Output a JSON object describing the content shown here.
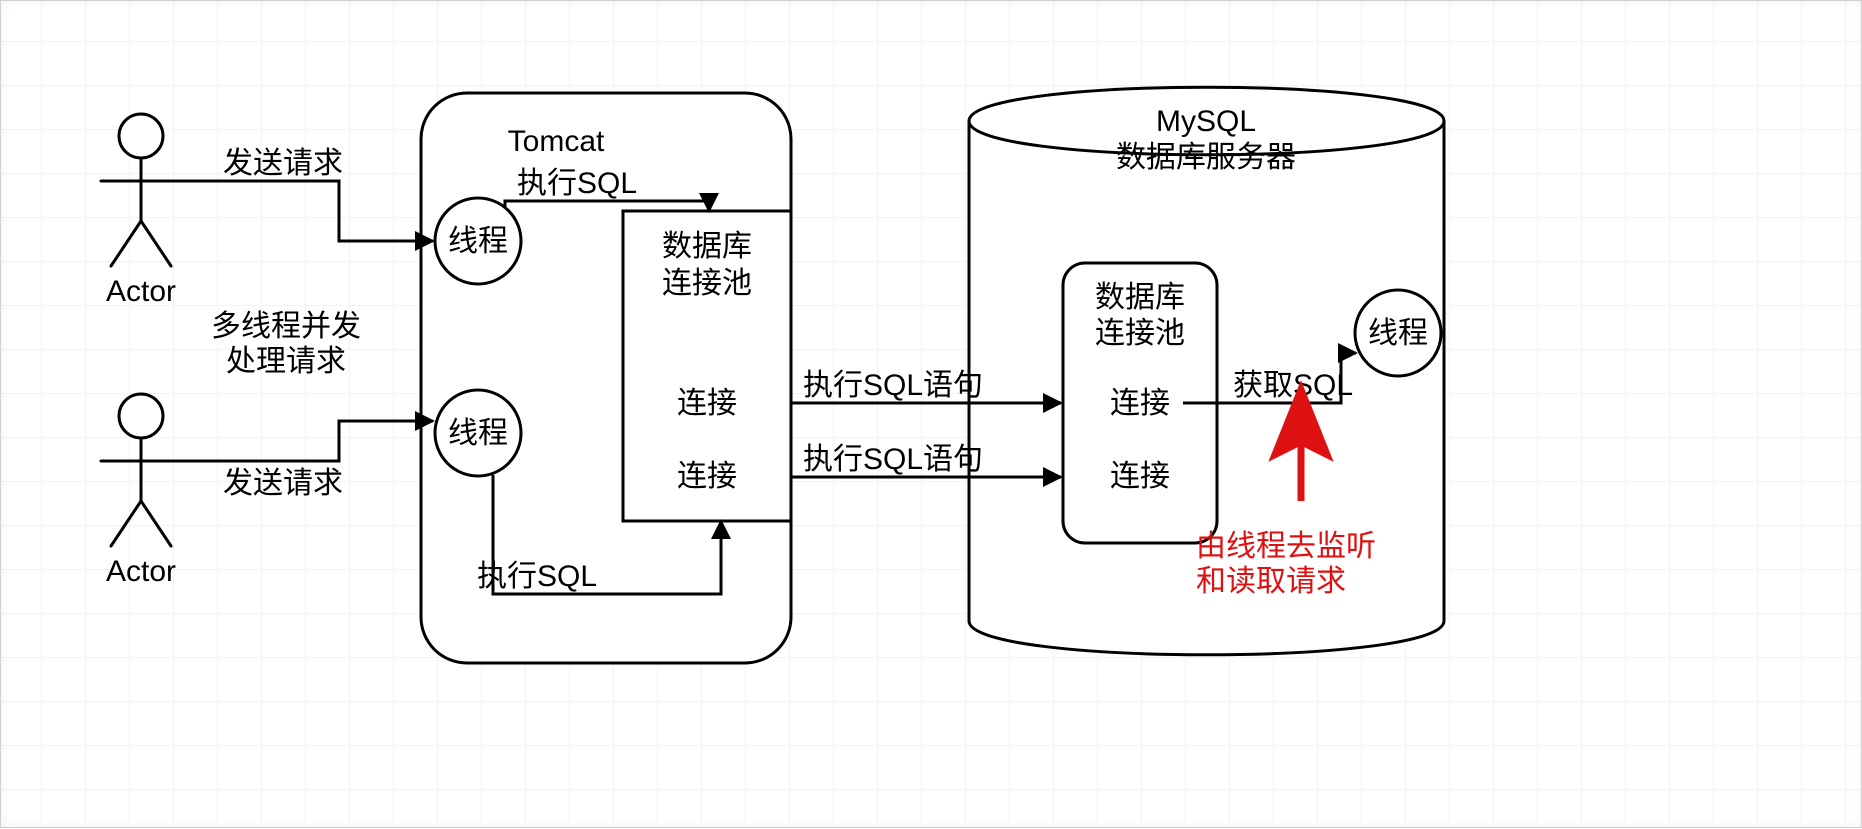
{
  "actors": {
    "top_label": "Actor",
    "bottom_label": "Actor"
  },
  "labels": {
    "send_request": "发送请求",
    "multithread_line1": "多线程并发",
    "multithread_line2": "处理请求",
    "exec_sql": "执行SQL",
    "exec_sql_stmt": "执行SQL语句",
    "get_sql": "获取SQL",
    "thread": "线程",
    "connection": "连接",
    "pool_line1": "数据库",
    "pool_line2": "连接池"
  },
  "tomcat": {
    "title": "Tomcat"
  },
  "mysql": {
    "title_line1": "MySQL",
    "title_line2": "数据库服务器"
  },
  "annotation": {
    "line1": "由线程去监听",
    "line2": "和读取请求"
  }
}
